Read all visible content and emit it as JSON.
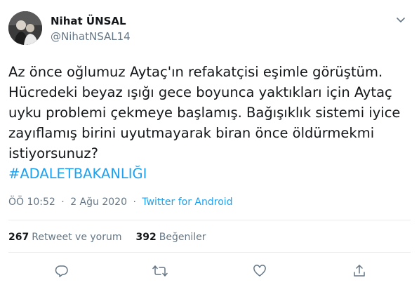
{
  "tweet": {
    "author": {
      "display_name": "Nihat ÜNSAL",
      "username": "@NihatNSAL14"
    },
    "text_lines": [
      "Az önce oğlumuz Aytaç'ın refakatçisi eşimle görüştüm.",
      "Hücredeki beyaz ışığı gece boyunca yaktıkları için Aytaç",
      "uyku problemi çekmeye başlamış. Bağışıklık sistemi iyice",
      "zayıflamış birini uyutmayarak biran önce öldürmekmi",
      "istiyorsunuz?"
    ],
    "hashtag": "#ADALETBAKANLIĞI",
    "time": "ÖÖ 10:52",
    "date": "2 Ağu 2020",
    "separator": "·",
    "source": "Twitter for Android",
    "stats": {
      "retweets_count": "267",
      "retweets_label": "Retweet ve yorum",
      "likes_count": "392",
      "likes_label": "Beğeniler"
    },
    "icons": {
      "more": "chevron-down-icon",
      "reply": "reply-icon",
      "retweet": "retweet-icon",
      "like": "heart-icon",
      "share": "share-icon"
    },
    "colors": {
      "accent": "#1da1f2",
      "text": "#14171a",
      "secondary": "#657786",
      "divider": "#e6ecf0"
    }
  }
}
